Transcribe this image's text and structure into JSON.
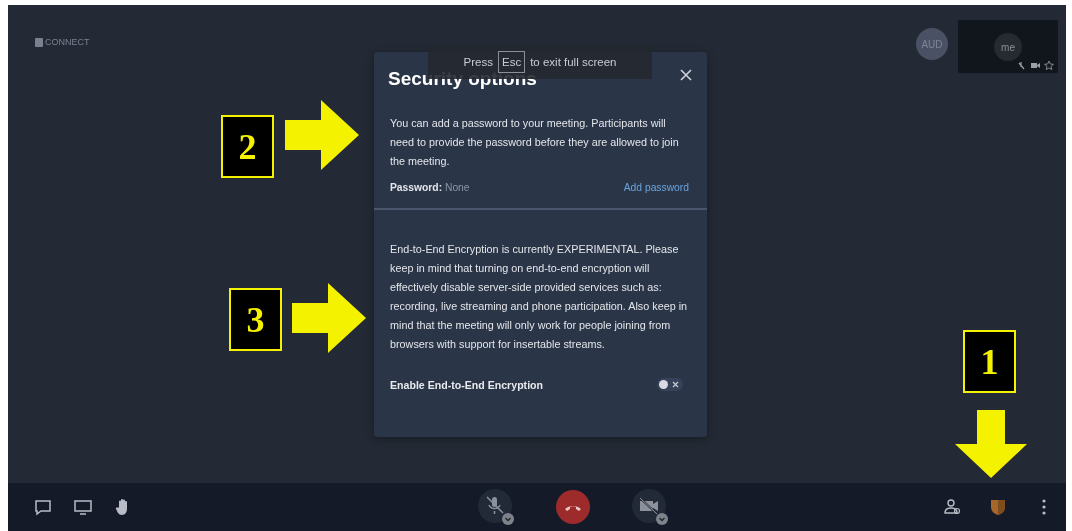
{
  "logo": "CONNECT",
  "fullscreen_notice": {
    "before": "Press",
    "key": "Esc",
    "after": "to exit full screen"
  },
  "participants": {
    "avatar": "AUD",
    "local_tile": {
      "name": "me"
    }
  },
  "dialog": {
    "title": "Security options",
    "password_section": {
      "description": "You can add a password to your meeting. Participants will need to provide the password before they are allowed to join the meeting.",
      "label": "Password:",
      "value": "None",
      "action": "Add password"
    },
    "e2ee_section": {
      "description": "End-to-End Encryption is currently EXPERIMENTAL. Please keep in mind that turning on end-to-end encryption will effectively disable server-side provided services such as: recording, live streaming and phone participation. Also keep in mind that the meeting will only work for people joining from browsers with support for insertable streams.",
      "toggle_label": "Enable End-to-End Encryption",
      "on": false
    }
  },
  "annotations": [
    {
      "number": "2",
      "kind": "right"
    },
    {
      "number": "3",
      "kind": "right"
    },
    {
      "number": "1",
      "kind": "down"
    }
  ]
}
